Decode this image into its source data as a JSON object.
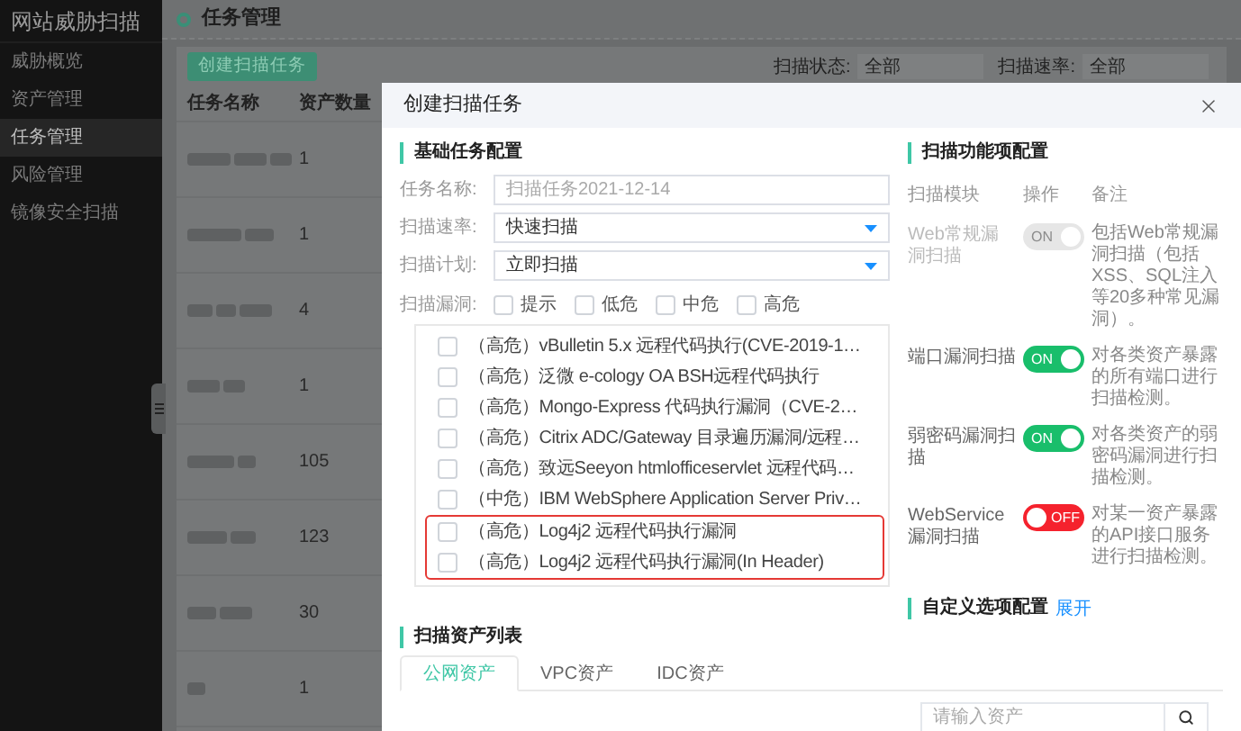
{
  "sidebar": {
    "title": "网站威胁扫描",
    "items": [
      {
        "label": "威胁概览",
        "selected": false
      },
      {
        "label": "资产管理",
        "selected": false
      },
      {
        "label": "任务管理",
        "selected": true
      },
      {
        "label": "风险管理",
        "selected": false
      },
      {
        "label": "镜像安全扫描",
        "selected": false
      }
    ]
  },
  "header": {
    "title": "任务管理"
  },
  "toolbar": {
    "create_button": "创建扫描任务",
    "filters": [
      {
        "label": "扫描状态:",
        "value": "全部"
      },
      {
        "label": "扫描速率:",
        "value": "全部"
      }
    ]
  },
  "table": {
    "columns": [
      "任务名称",
      "资产数量"
    ],
    "rows": [
      {
        "asset_count": "1"
      },
      {
        "asset_count": "1"
      },
      {
        "asset_count": "4"
      },
      {
        "asset_count": "1"
      },
      {
        "asset_count": "105"
      },
      {
        "asset_count": "123"
      },
      {
        "asset_count": "30"
      },
      {
        "asset_count": "1"
      }
    ]
  },
  "dialog": {
    "title": "创建扫描任务",
    "basic": {
      "title": "基础任务配置",
      "fields": [
        {
          "label": "任务名称:",
          "kind": "input",
          "placeholder": "扫描任务2021-12-14"
        },
        {
          "label": "扫描速率:",
          "kind": "select",
          "value": "快速扫描"
        },
        {
          "label": "扫描计划:",
          "kind": "select",
          "value": "立即扫描"
        }
      ],
      "vuln_label": "扫描漏洞:",
      "levels": [
        {
          "label": "提示",
          "checked": false
        },
        {
          "label": "低危",
          "checked": false
        },
        {
          "label": "中危",
          "checked": false
        },
        {
          "label": "高危",
          "checked": false
        }
      ],
      "vulns": [
        {
          "label": "（高危）vBulletin 5.x 远程代码执行(CVE-2019-1…",
          "checked": false
        },
        {
          "label": "（高危）泛微 e-cology OA BSH远程代码执行",
          "checked": false
        },
        {
          "label": "（高危）Mongo-Express 代码执行漏洞（CVE-2…",
          "checked": false
        },
        {
          "label": "（高危）Citrix ADC/Gateway 目录遍历漏洞/远程…",
          "checked": false
        },
        {
          "label": "（高危）致远Seeyon htmlofficeservlet 远程代码…",
          "checked": false
        },
        {
          "label": "（中危）IBM WebSphere Application Server Priv…",
          "checked": false
        }
      ],
      "highlighted_vulns": [
        {
          "label": "（高危）Log4j2 远程代码执行漏洞",
          "checked": false
        },
        {
          "label": "（高危）Log4j2 远程代码执行漏洞(In Header)",
          "checked": false
        }
      ]
    },
    "features": {
      "title": "扫描功能项配置",
      "columns": [
        "扫描模块",
        "操作",
        "备注"
      ],
      "rows": [
        {
          "module": "Web常规漏洞扫描",
          "on": true,
          "disabled": true,
          "toggle_text": "ON",
          "note": "包括Web常规漏洞扫描（包括XSS、SQL注入等20多种常见漏洞）。"
        },
        {
          "module": "端口漏洞扫描",
          "on": true,
          "disabled": false,
          "toggle_text": "ON",
          "note": "对各类资产暴露的所有端口进行扫描检测。"
        },
        {
          "module": "弱密码漏洞扫描",
          "on": true,
          "disabled": false,
          "toggle_text": "ON",
          "note": "对各类资产的弱密码漏洞进行扫描检测。"
        },
        {
          "module": "WebService漏洞扫描",
          "on": false,
          "disabled": false,
          "toggle_text": "OFF",
          "note": "对某一资产暴露的API接口服务进行扫描检测。"
        }
      ]
    },
    "custom": {
      "title": "自定义选项配置",
      "link": "展开"
    },
    "assets": {
      "title": "扫描资产列表",
      "tabs": [
        {
          "label": "公网资产",
          "selected": true
        },
        {
          "label": "VPC资产",
          "selected": false
        },
        {
          "label": "IDC资产",
          "selected": false
        }
      ],
      "search": {
        "placeholder": "请输入资产"
      }
    }
  }
}
